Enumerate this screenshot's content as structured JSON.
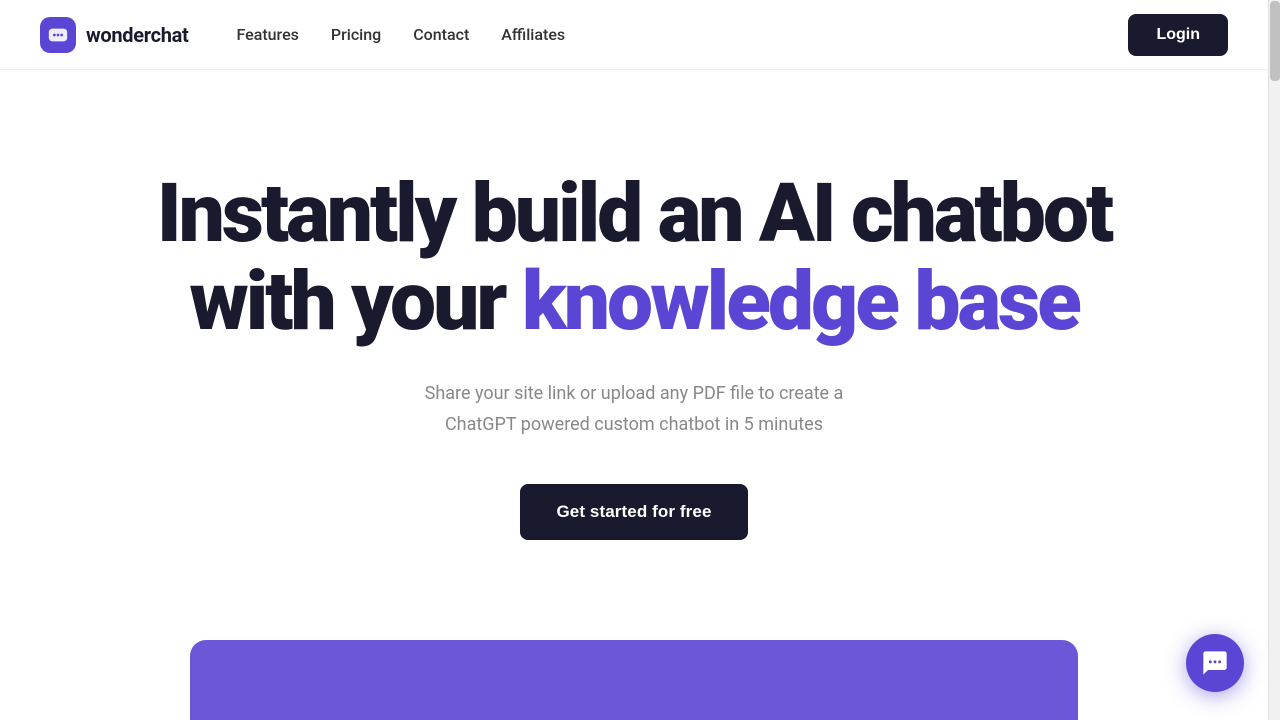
{
  "brand": {
    "logo_text": "wonderchat",
    "logo_icon_alt": "wonderchat logo"
  },
  "nav": {
    "links": [
      {
        "label": "Features",
        "href": "#features"
      },
      {
        "label": "Pricing",
        "href": "#pricing"
      },
      {
        "label": "Contact",
        "href": "#contact"
      },
      {
        "label": "Affiliates",
        "href": "#affiliates"
      }
    ],
    "login_label": "Login"
  },
  "hero": {
    "title_line1": "Instantly build an AI chatbot",
    "title_line2_plain": "with your ",
    "title_line2_highlight": "knowledge base",
    "subtitle_line1": "Share your site link or upload any PDF file to create a",
    "subtitle_line2": "ChatGPT powered custom chatbot in 5 minutes",
    "cta_label": "Get started for free"
  },
  "chat_widget": {
    "icon_alt": "chat-icon"
  }
}
